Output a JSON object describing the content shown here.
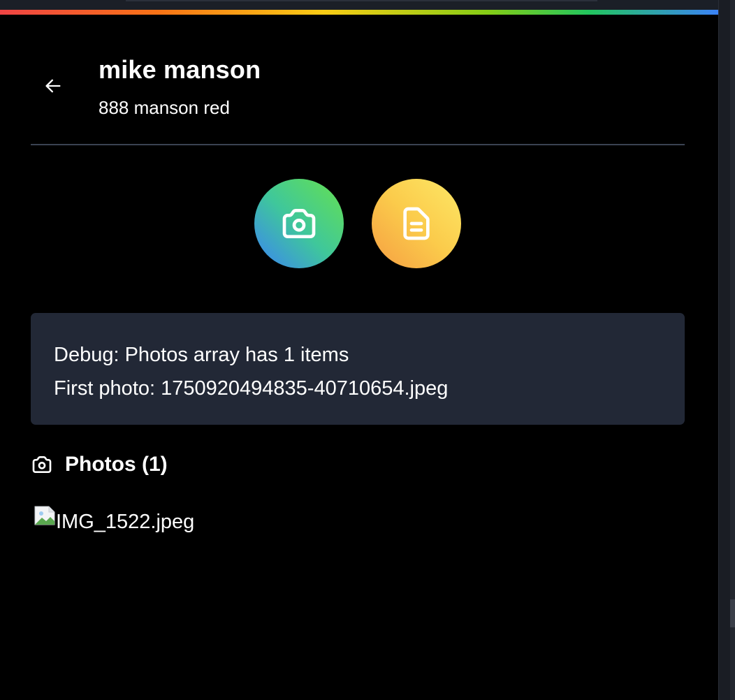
{
  "header": {
    "title": "mike manson",
    "subtitle": "888 manson red",
    "back_icon": "arrow-left-icon"
  },
  "actions": {
    "camera_icon": "camera-icon",
    "document_icon": "document-icon"
  },
  "debug": {
    "line1": "Debug: Photos array has 1 items",
    "line2": "First photo: 1750920494835-40710654.jpeg"
  },
  "photos": {
    "header_label": "Photos (1)",
    "header_icon": "camera-icon",
    "items": [
      {
        "alt": "IMG_1522.jpeg",
        "icon": "broken-image-icon"
      }
    ]
  },
  "colors": {
    "background": "#000000",
    "debug_bg": "#222836",
    "divider": "#3a4352",
    "camera_gradient": [
      "#3b82f6",
      "#3fc79b",
      "#66e14f"
    ],
    "document_gradient": [
      "#f59e42",
      "#fbcb4b",
      "#fde866"
    ]
  }
}
